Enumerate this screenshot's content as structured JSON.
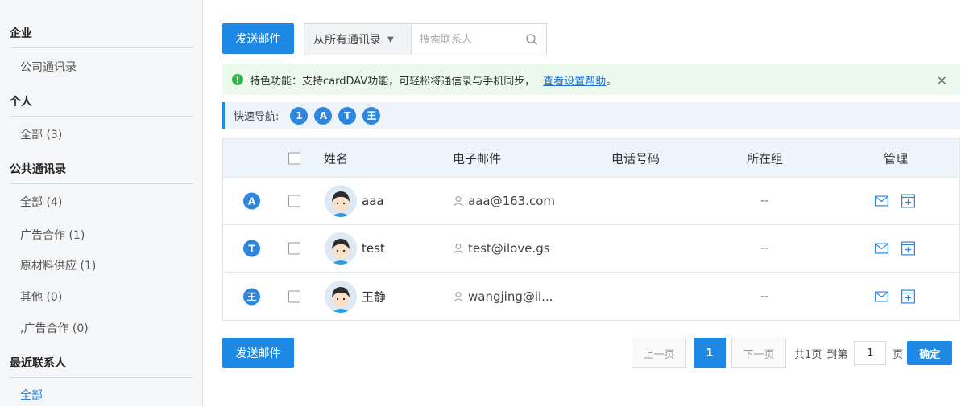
{
  "sidebar": {
    "sections": [
      {
        "title": "企业",
        "items": [
          {
            "label": "公司通讯录"
          }
        ]
      },
      {
        "title": "个人",
        "items": [
          {
            "label": "全部 (3)"
          }
        ]
      },
      {
        "title": "公共通讯录",
        "items": [
          {
            "label": "全部 (4)"
          },
          {
            "label": "广告合作 (1)"
          },
          {
            "label": "原材料供应 (1)"
          },
          {
            "label": "其他 (0)"
          },
          {
            "label": ",广告合作 (0)"
          }
        ]
      },
      {
        "title": "最近联系人",
        "items": [
          {
            "label": "全部",
            "active": true
          }
        ]
      }
    ]
  },
  "toolbar": {
    "send_label": "发送邮件",
    "scope_label": "从所有通讯录",
    "search_placeholder": "搜索联系人"
  },
  "notice": {
    "text": "特色功能：支持cardDAV功能，可轻松将通信录与手机同步，",
    "link": "查看设置帮助",
    "end": "。",
    "close": "×"
  },
  "quicknav": {
    "label": "快速导航:",
    "letters": [
      "1",
      "A",
      "T",
      "王"
    ]
  },
  "table": {
    "headers": {
      "name": "姓名",
      "email": "电子邮件",
      "phone": "电话号码",
      "group": "所在组",
      "manage": "管理"
    },
    "rows": [
      {
        "letter": "A",
        "name": "aaa",
        "email": "aaa@163.com",
        "phone": "",
        "group": "--"
      },
      {
        "letter": "T",
        "name": "test",
        "email": "test@ilove.gs",
        "phone": "",
        "group": "--"
      },
      {
        "letter": "王",
        "name": "王静",
        "email": "wangjing@il...",
        "phone": "",
        "group": "--"
      }
    ]
  },
  "bottom": {
    "send_label": "发送邮件"
  },
  "pagination": {
    "prev": "上一页",
    "current": "1",
    "next": "下一页",
    "total": "共1页",
    "goto": "到第",
    "page_value": "1",
    "page_unit": "页",
    "confirm": "确定"
  },
  "colors": {
    "accent": "#1e88e5",
    "notice_bg": "#ecfaee",
    "badge": "#2e86de"
  }
}
